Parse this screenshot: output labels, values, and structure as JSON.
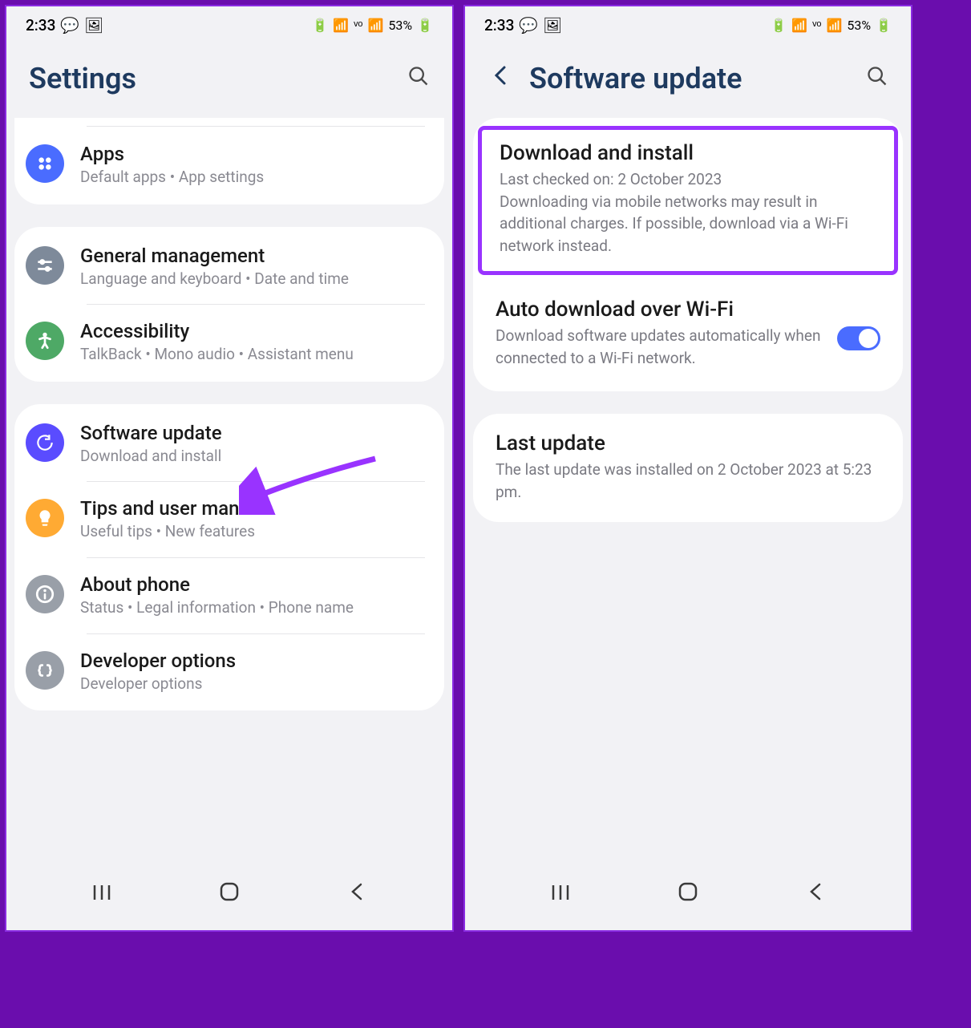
{
  "status": {
    "time": "2:33",
    "battery": "53%"
  },
  "left": {
    "title": "Settings",
    "groups": [
      {
        "partial": true,
        "items": [
          {
            "icon": "apps",
            "title": "Apps",
            "sub": "Default apps  •  App settings"
          }
        ]
      },
      {
        "items": [
          {
            "icon": "general",
            "title": "General management",
            "sub": "Language and keyboard  •  Date and time"
          },
          {
            "icon": "access",
            "title": "Accessibility",
            "sub": "TalkBack  •  Mono audio  •  Assistant menu"
          }
        ]
      },
      {
        "items": [
          {
            "icon": "software",
            "title": "Software update",
            "sub": "Download and install"
          },
          {
            "icon": "tips",
            "title": "Tips and user manual",
            "sub": "Useful tips  •  New features"
          },
          {
            "icon": "about",
            "title": "About phone",
            "sub": "Status  •  Legal information  •  Phone name"
          },
          {
            "icon": "dev",
            "title": "Developer options",
            "sub": "Developer options"
          }
        ]
      }
    ]
  },
  "right": {
    "title": "Software update",
    "download": {
      "title": "Download and install",
      "sub": "Last checked on: 2 October 2023\nDownloading via mobile networks may result in additional charges. If possible, download via a Wi-Fi network instead."
    },
    "auto": {
      "title": "Auto download over Wi-Fi",
      "sub": "Download software updates automatically when connected to a Wi-Fi network.",
      "enabled": true
    },
    "last": {
      "title": "Last update",
      "sub": "The last update was installed on 2 October 2023 at 5:23 pm."
    }
  }
}
